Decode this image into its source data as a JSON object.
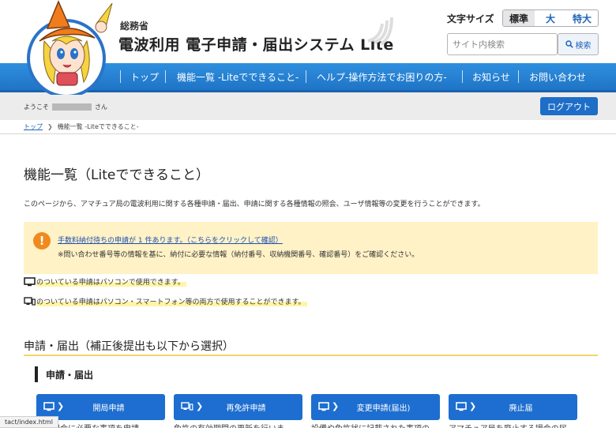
{
  "header": {
    "ministry": "総務省",
    "title": "電波利用 電子申請・届出システム Lite",
    "font_size_label": "文字サイズ",
    "font_sizes": [
      "標準",
      "大",
      "特大"
    ],
    "search_placeholder": "サイト内検索",
    "search_button": "検索"
  },
  "nav": {
    "items": [
      "トップ",
      "機能一覧 -Liteでできること-",
      "ヘルプ-操作方法でお困りの方-",
      "お知らせ",
      "お問い合わせ"
    ]
  },
  "user": {
    "welcome_prefix": "ようこそ",
    "welcome_suffix": "さん",
    "logout": "ログアウト"
  },
  "breadcrumb": {
    "home": "トップ",
    "current": "機能一覧 -Liteでできること-"
  },
  "main": {
    "title": "機能一覧（Liteでできること）",
    "intro": "このページから、アマチュア局の電波利用に関する各種申請・届出、申請に関する各種情報の照会、ユーザ情報等の変更を行うことができます。",
    "notice_icon": "!",
    "notice_link": "手数料納付待ちの申請が 1 件あります。（こちらをクリックして確認）",
    "notice_sub": "※問い合わせ番号等の情報を基に、納付に必要な情報（納付番号、収納機関番号、確認番号）をご確認ください。",
    "legend_pc": "のついている申請はパソコンで使用できます。",
    "legend_both": "のついている申請はパソコン・スマートフォン等の両方で使用することができます。",
    "section_title": "申請・届出（補正後提出も以下から選択）",
    "sub_title": "申請・届出"
  },
  "cards": [
    {
      "label": "開局申請",
      "icon": "pc-icon",
      "desc": "する場合に必要な事項を申請"
    },
    {
      "label": "再免許申請",
      "icon": "pc-mobile-icon",
      "desc": "免許の有効期間の更新を行いま"
    },
    {
      "label": "変更申請(届出)",
      "icon": "pc-icon",
      "desc": "設備や免許状に記載された事項の"
    },
    {
      "label": "廃止届",
      "icon": "pc-icon",
      "desc": "アマチュア局を廃止する場合の届"
    }
  ],
  "status_bar": {
    "url": "tact/index.html"
  },
  "colors": {
    "nav_blue": "#1f74c6",
    "card_blue": "#1d6ed0",
    "notice_bg": "#fff2c6",
    "notice_icon": "#f08a1e",
    "section_rule": "#f4d46a"
  }
}
